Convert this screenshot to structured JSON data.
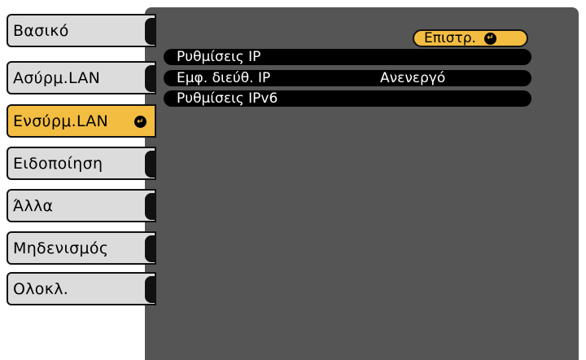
{
  "sidebar": {
    "items": [
      {
        "label": "Βασικό",
        "active": false
      },
      {
        "label": "Ασύρμ.LAN",
        "active": false
      },
      {
        "label": "Ενσύρμ.LAN",
        "active": true
      },
      {
        "label": "Ειδοποίηση",
        "active": false
      },
      {
        "label": "Άλλα",
        "active": false
      },
      {
        "label": "Μηδενισμός",
        "active": false
      },
      {
        "label": "Ολοκλ.",
        "active": false
      }
    ]
  },
  "main": {
    "back_label": "Επιστρ.",
    "rows": [
      {
        "label": "Ρυθμίσεις IP",
        "value": ""
      },
      {
        "label": "Εμφ. διεύθ. IP",
        "value": "Ανενεργό"
      },
      {
        "label": "Ρυθμίσεις IPv6",
        "value": ""
      }
    ]
  },
  "icons": {
    "enter": "enter-icon"
  },
  "colors": {
    "accent": "#f3bd42",
    "panel": "#555555",
    "tab": "#dcdcdc",
    "row": "#000000"
  }
}
